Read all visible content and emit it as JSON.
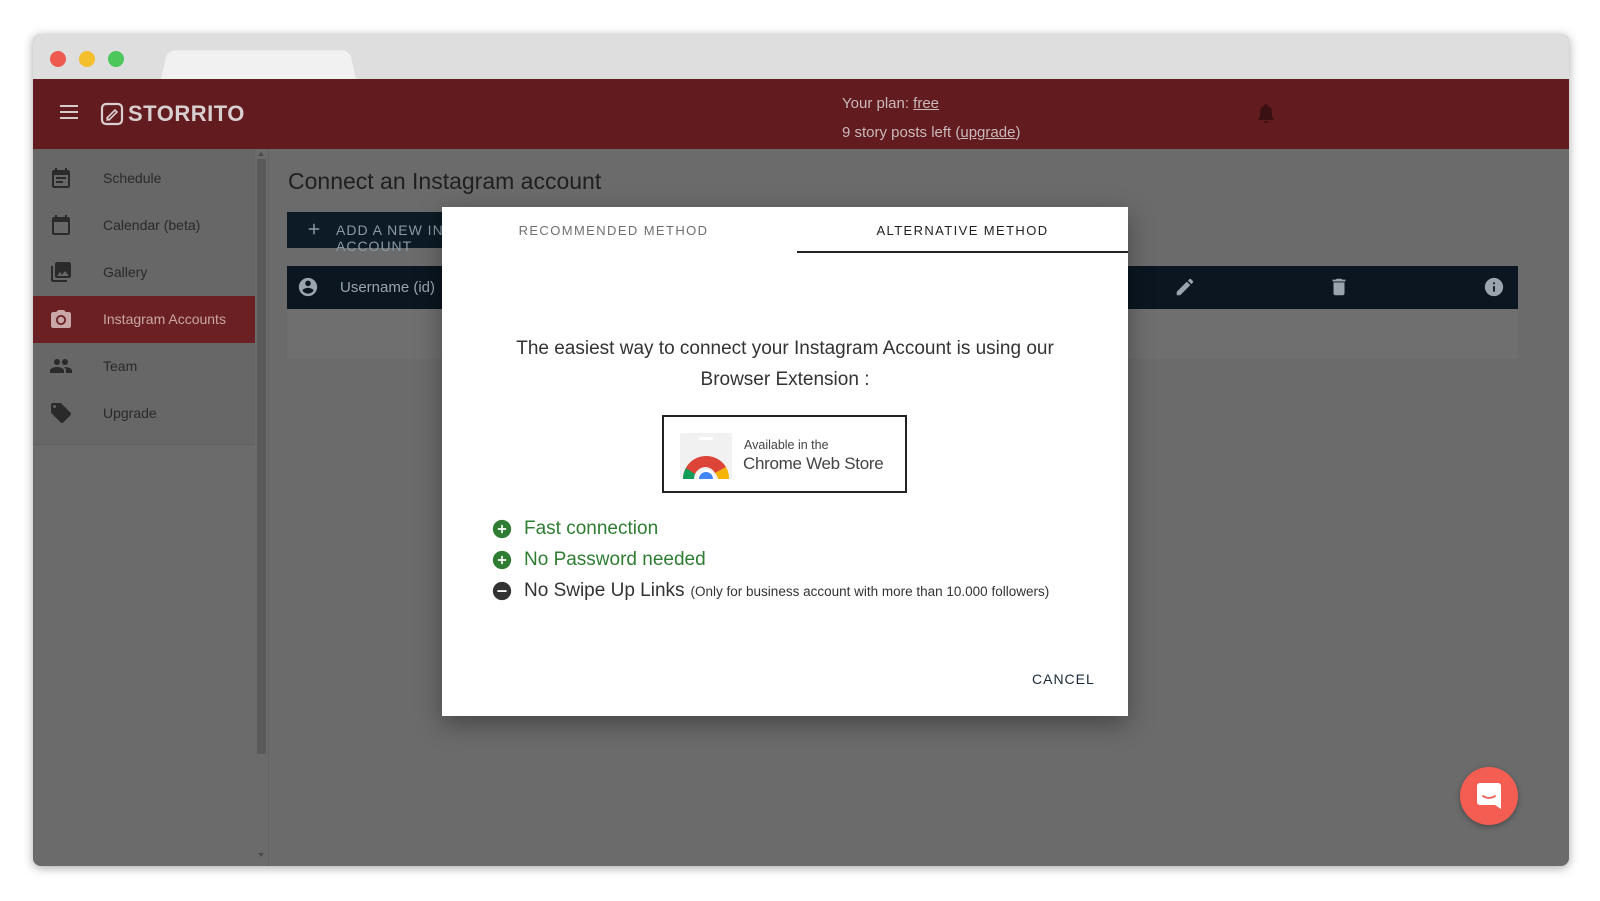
{
  "app": {
    "logo_text": "STORRITO",
    "plan_label": "Your plan: ",
    "plan_value": "free",
    "posts_left_text": "9 story posts left (",
    "upgrade_link": "upgrade",
    "posts_left_close": ")"
  },
  "sidebar": {
    "items": [
      {
        "label": "Schedule",
        "icon": "schedule-icon"
      },
      {
        "label": "Calendar (beta)",
        "icon": "calendar-icon"
      },
      {
        "label": "Gallery",
        "icon": "gallery-icon"
      },
      {
        "label": "Instagram Accounts",
        "icon": "camera-icon",
        "active": true
      },
      {
        "label": "Team",
        "icon": "team-icon"
      },
      {
        "label": "Upgrade",
        "icon": "tag-icon"
      }
    ]
  },
  "main": {
    "title": "Connect an Instagram account",
    "add_button_label": "ADD A NEW INSTAGRAM ACCOUNT",
    "table_column_user": "Username (id)"
  },
  "modal": {
    "tabs": [
      {
        "label": "RECOMMENDED METHOD",
        "active": false
      },
      {
        "label": "ALTERNATIVE METHOD",
        "active": true
      }
    ],
    "intro_text": "The easiest way to connect your Instagram Account is using our Browser Extension :",
    "store_badge": {
      "line1": "Available in the",
      "line2": "Chrome Web Store"
    },
    "features": [
      {
        "text": "Fast connection",
        "kind": "good"
      },
      {
        "text": "No Password needed",
        "kind": "good"
      },
      {
        "text": "No Swipe Up Links",
        "note": "(Only for business account with more than 10.000 followers)",
        "kind": "bad"
      }
    ],
    "cancel_label": "CANCEL"
  },
  "colors": {
    "header_bg": "#621b1f",
    "active_nav_bg": "#6b2123",
    "good_green": "#2e7d32",
    "chat_button": "#f45d52"
  }
}
